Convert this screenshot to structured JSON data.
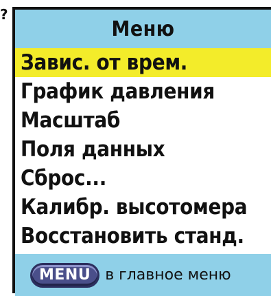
{
  "edge_mark": "?",
  "header": {
    "title": "Меню"
  },
  "menu": {
    "items": [
      {
        "label": "Завис. от врем.",
        "selected": true
      },
      {
        "label": "График давления",
        "selected": false
      },
      {
        "label": "Масштаб",
        "selected": false
      },
      {
        "label": "Поля данных",
        "selected": false
      },
      {
        "label": "Сброс...",
        "selected": false
      },
      {
        "label": "Калибр. высотомера",
        "selected": false
      },
      {
        "label": "Восстановить станд.",
        "selected": false
      }
    ]
  },
  "footer": {
    "key_label": "MENU",
    "hint": "в главное меню"
  },
  "colors": {
    "bar_blue": "#8fd0e8",
    "highlight_yellow": "#f3ec2a",
    "key_purple": "#4a4f8a"
  }
}
